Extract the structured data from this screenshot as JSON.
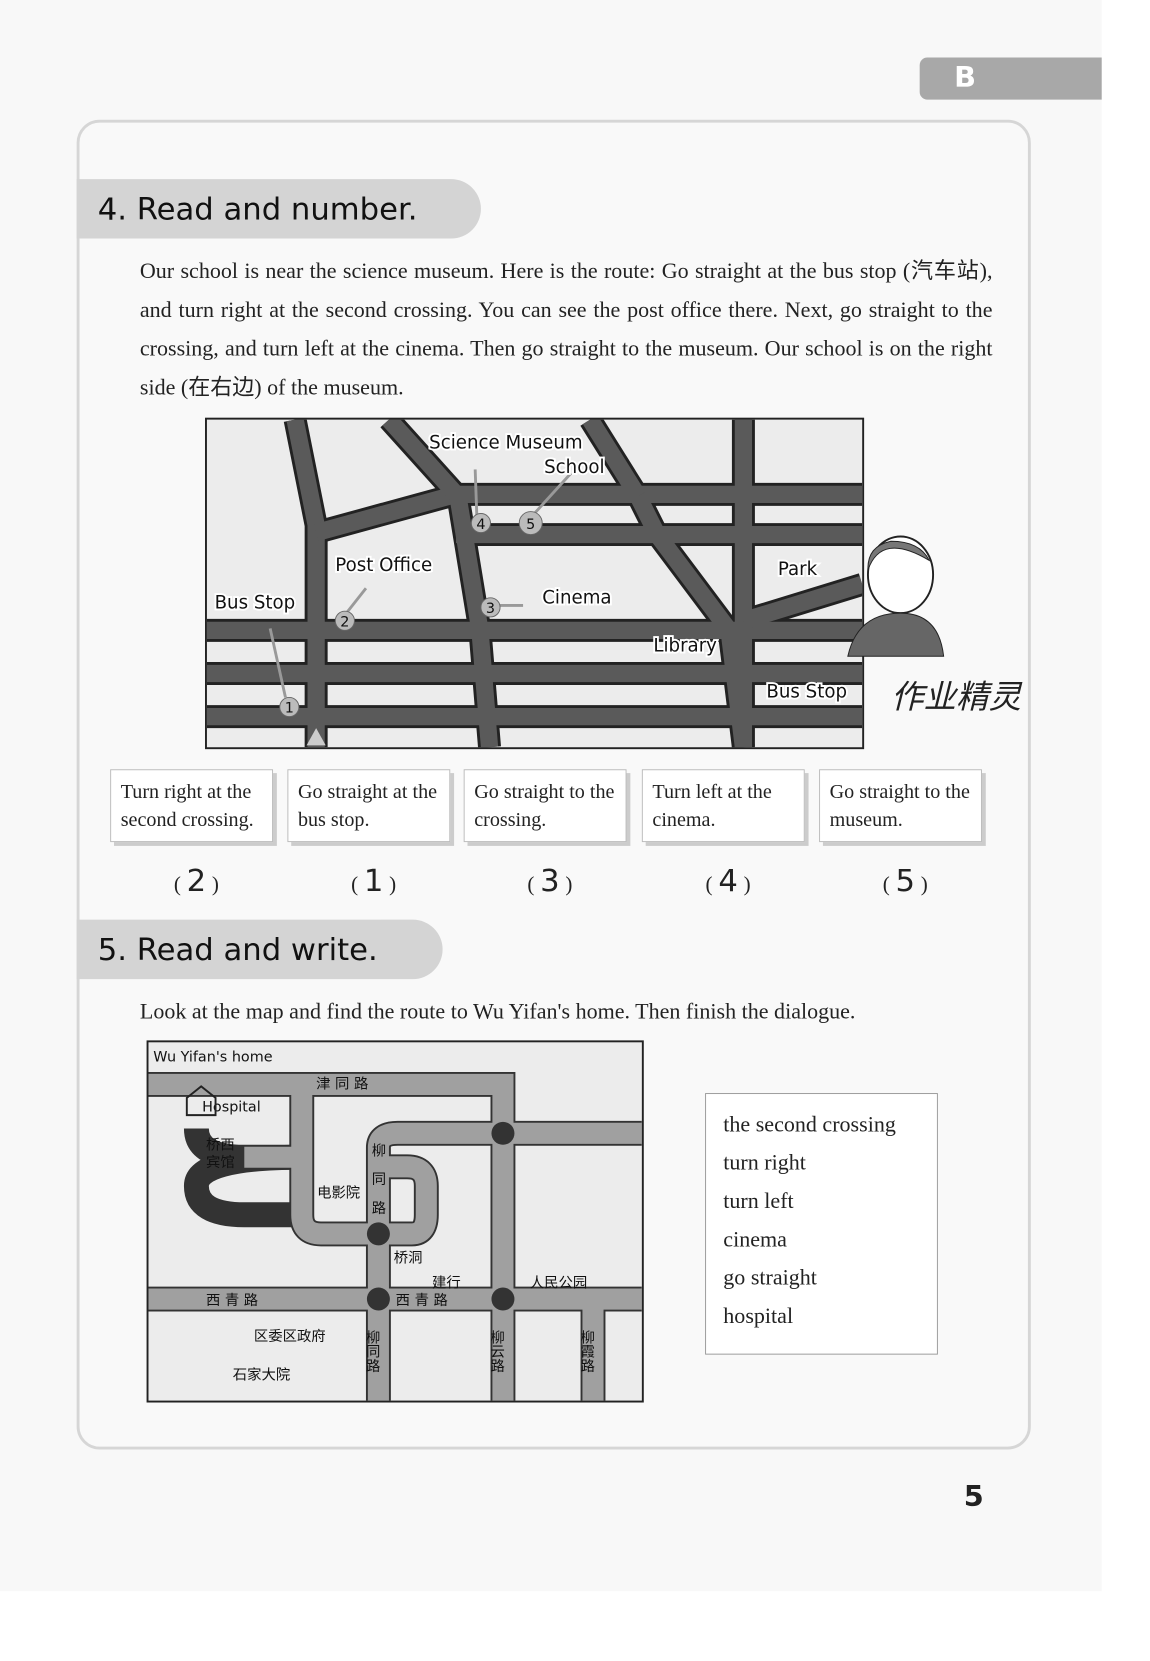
{
  "tab_letter": "B",
  "section4": {
    "title": "4. Read and number.",
    "paragraph": "Our school is near the science museum. Here is the route: Go straight at the bus stop (汽车站), and turn right at the second crossing. You can see the post office there. Next, go straight to the crossing, and turn left at the cinema. Then go straight to the museum. Our school is on the right side (在右边) of the museum.",
    "map_labels": {
      "science_museum": "Science Museum",
      "school": "School",
      "post_office": "Post Office",
      "bus_stop_left": "Bus Stop",
      "cinema": "Cinema",
      "library": "Library",
      "park": "Park",
      "bus_stop_right": "Bus Stop"
    },
    "route_markers": [
      "1",
      "2",
      "3",
      "4",
      "5"
    ],
    "handwriting": "作业精灵",
    "boxes": [
      {
        "text": "Turn right at the second crossing.",
        "answer": "2"
      },
      {
        "text": "Go straight at the bus stop.",
        "answer": "1"
      },
      {
        "text": "Go straight to the crossing.",
        "answer": "3"
      },
      {
        "text": "Turn left at the cinema.",
        "answer": "4"
      },
      {
        "text": "Go straight to the museum.",
        "answer": "5"
      }
    ]
  },
  "section5": {
    "title": "5. Read and write.",
    "instruction": "Look at the map and find the route to Wu Yifan's home. Then finish the dialogue.",
    "map_labels": {
      "home": "Wu Yifan's home",
      "hospital": "Hospital",
      "jintong_road": "津 同 路",
      "hotel_1": "桥西",
      "hotel_2": "宾馆",
      "cinema": "电影院",
      "liutong_1": "柳",
      "liutong_2": "同",
      "liutong_3": "路",
      "qiaodong": "桥洞",
      "jianhang": "建行",
      "park": "人民公园",
      "xiqing_left": "西 青 路",
      "xiqing_right": "西 青 路",
      "gov": "区委区政府",
      "shijia": "石家大院",
      "liuyun": "柳云路",
      "liuxia": "柳霞路",
      "liutong_s": "柳同路"
    },
    "words": [
      "the second crossing",
      "turn right",
      "turn left",
      "cinema",
      "go straight",
      "hospital"
    ]
  },
  "page_number": "5"
}
